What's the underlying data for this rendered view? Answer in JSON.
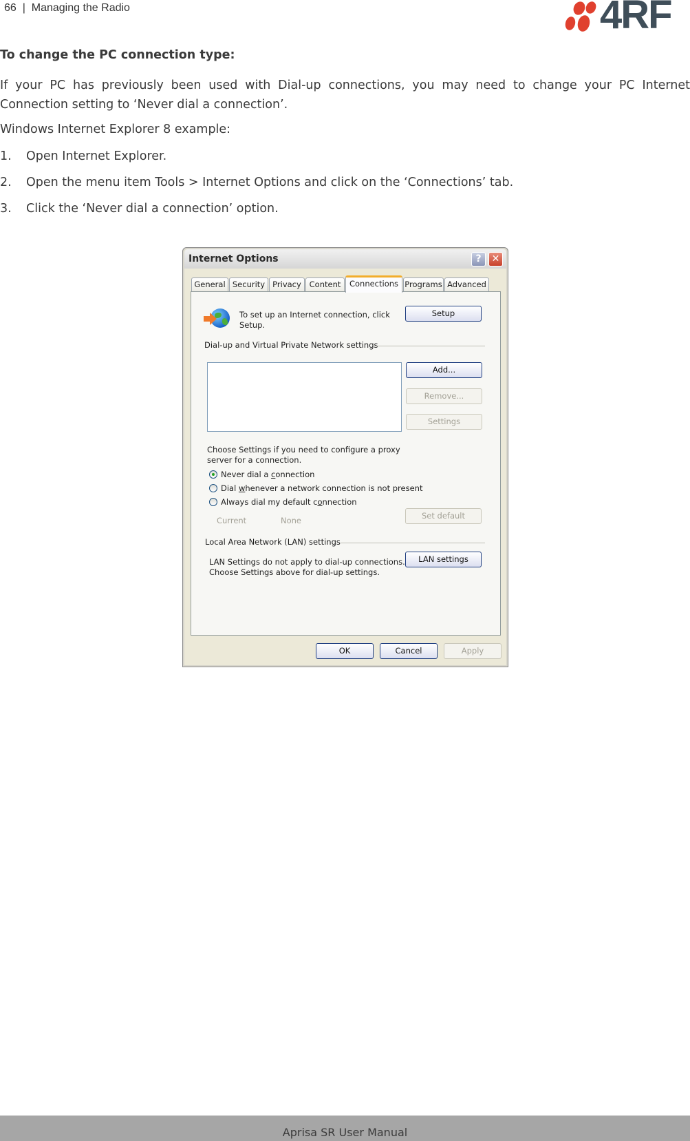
{
  "header": {
    "page_number": "66",
    "separator": "|",
    "section": "Managing the Radio",
    "logo_text": "4RF",
    "logo_colors": {
      "dots": "#e0402e",
      "wordmark": "#3f4e59"
    }
  },
  "content": {
    "heading": "To change the PC connection type:",
    "intro": "If your PC has previously been used with Dial-up connections, you may need to change your PC Internet Connection setting to ‘Never dial a connection’.",
    "example_label": "Windows Internet Explorer 8 example:",
    "steps": [
      {
        "num": "1.",
        "text": "Open Internet Explorer."
      },
      {
        "num": "2.",
        "text": "Open the menu item Tools > Internet Options and click on the ‘Connections’ tab."
      },
      {
        "num": "3.",
        "text": "Click the ‘Never dial a connection’ option."
      }
    ]
  },
  "dialog": {
    "title": "Internet Options",
    "help_glyph": "?",
    "close_glyph": "✕",
    "tabs": [
      {
        "label": "General",
        "active": false
      },
      {
        "label": "Security",
        "active": false
      },
      {
        "label": "Privacy",
        "active": false
      },
      {
        "label": "Content",
        "active": false
      },
      {
        "label": "Connections",
        "active": true
      },
      {
        "label": "Programs",
        "active": false
      },
      {
        "label": "Advanced",
        "active": false
      }
    ],
    "setup": {
      "icon": "globe-arrow-icon",
      "text": "To set up an Internet connection, click Setup.",
      "button": "Setup"
    },
    "dialup": {
      "group_label": "Dial-up and Virtual Private Network settings",
      "list_items": [],
      "buttons": [
        {
          "label": "Add...",
          "enabled": true
        },
        {
          "label": "Remove...",
          "enabled": false
        },
        {
          "label": "Settings",
          "enabled": false
        }
      ],
      "proxy_text": "Choose Settings if you need to configure a proxy server for a connection.",
      "options": [
        {
          "pre": "Never dial a ",
          "ul": "c",
          "post": "onnection",
          "checked": true
        },
        {
          "pre": "Dial ",
          "ul": "w",
          "post": "henever a network connection is not present",
          "checked": false
        },
        {
          "pre": "Always dial my default c",
          "ul": "o",
          "post": "nnection",
          "checked": false
        }
      ],
      "current_label": "Current",
      "current_value": "None",
      "set_default": "Set default"
    },
    "lan": {
      "group_label": "Local Area Network (LAN) settings",
      "text": "LAN Settings do not apply to dial-up connections. Choose Settings above for dial-up settings.",
      "button": "LAN settings"
    },
    "footer_buttons": [
      {
        "label": "OK",
        "enabled": true
      },
      {
        "label": "Cancel",
        "enabled": true
      },
      {
        "label": "Apply",
        "enabled": false
      }
    ]
  },
  "footer": {
    "text": "Aprisa SR User Manual"
  }
}
